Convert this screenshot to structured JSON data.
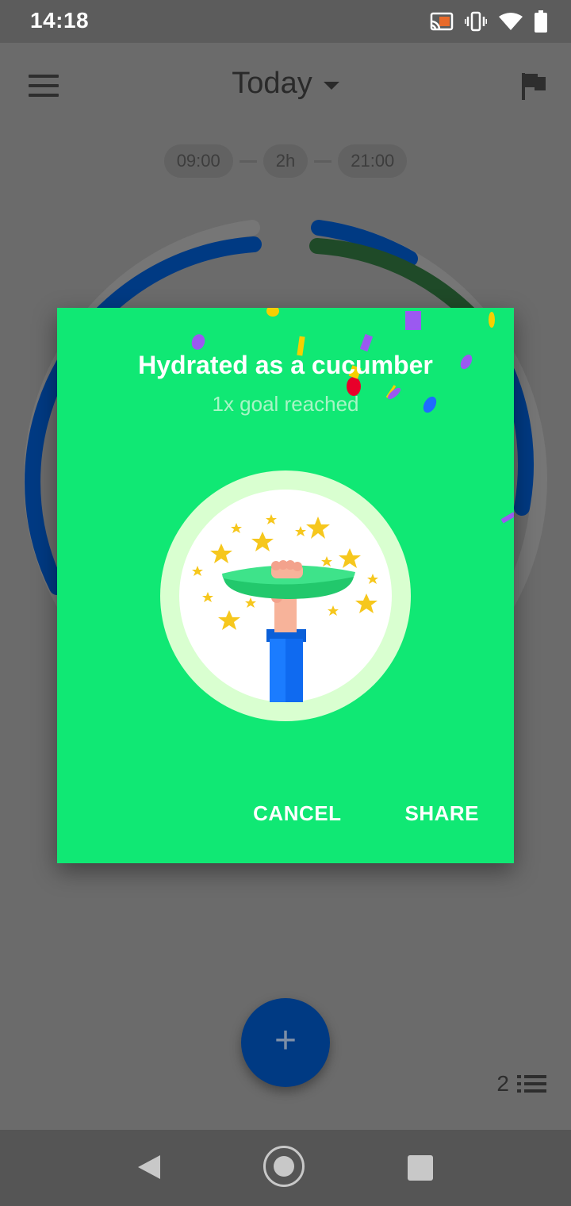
{
  "status": {
    "time": "14:18",
    "icons": [
      "cast-icon",
      "vibrate-icon",
      "wifi-icon",
      "battery-icon"
    ]
  },
  "appbar": {
    "title": "Today",
    "menu_icon": "hamburger-menu-icon",
    "flag_icon": "flag-icon"
  },
  "range": {
    "start": "09:00",
    "interval": "2h",
    "end": "21:00"
  },
  "dialog": {
    "title": "Hydrated as a cucumber",
    "subtitle": "1x goal reached",
    "badge_icon": "cucumber-trophy-badge",
    "cancel_label": "CANCEL",
    "share_label": "SHARE"
  },
  "fab": {
    "label": "+"
  },
  "entries": {
    "count": "2"
  },
  "colors": {
    "dialog_bg": "#10e874",
    "fab": "#003a83",
    "ring_blue": "#003a83",
    "ring_green": "#1f4a28",
    "dim_bg": "#6b6b6b"
  }
}
